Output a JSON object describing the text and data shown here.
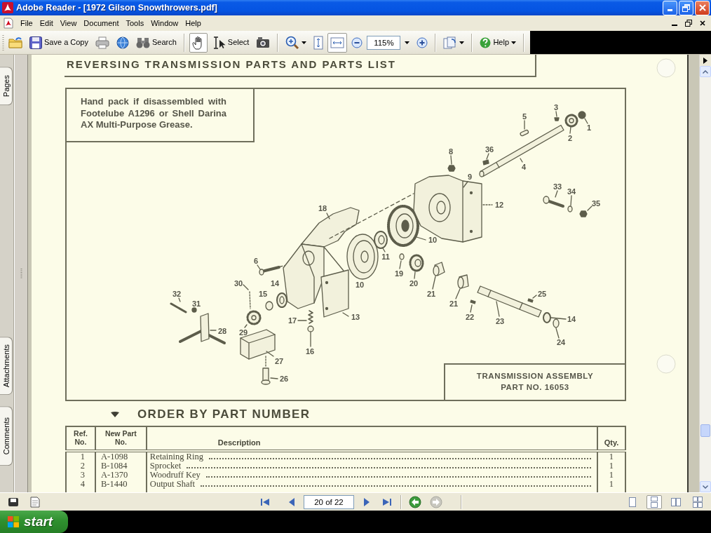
{
  "window": {
    "title": "Adobe Reader - [1972 Gilson Snowthrowers.pdf]"
  },
  "menu": [
    "File",
    "Edit",
    "View",
    "Document",
    "Tools",
    "Window",
    "Help"
  ],
  "toolbar": {
    "save_label": "Save a Copy",
    "search_label": "Search",
    "tools": [
      {
        "selected": true
      },
      {
        "label": "Select",
        "selected": false
      },
      {
        "selected": false
      }
    ],
    "page_fit": [
      {
        "selected": false
      },
      {
        "selected": true
      }
    ],
    "zoom": "115%",
    "help_label": "Help"
  },
  "nav_tabs": [
    "Pages",
    "Attachments",
    "Comments"
  ],
  "page": {
    "heading": "REVERSING TRANSMISSION PARTS AND PARTS LIST",
    "note": "Hand pack if disassembled with Footelube A1296 or Shell Darina AX Multi-Purpose Grease.",
    "callouts": [
      "3",
      "5",
      "1",
      "2",
      "8",
      "36",
      "4",
      "9",
      "33",
      "34",
      "18",
      "12",
      "35",
      "10",
      "6",
      "11",
      "19",
      "30",
      "14",
      "10",
      "20",
      "32",
      "15",
      "21",
      "25",
      "31",
      "21",
      "17",
      "13",
      "22",
      "23",
      "14",
      "28",
      "29",
      "24",
      "16",
      "27",
      "26"
    ],
    "assembly": {
      "title": "TRANSMISSION ASSEMBLY",
      "part_no": "PART NO. 16053"
    },
    "order_heading": "ORDER BY PART NUMBER",
    "table": {
      "columns": [
        "Ref. No.",
        "New Part No.",
        "Description",
        "Qty."
      ],
      "rows": [
        {
          "ref": "1",
          "part": "A-1098",
          "description": "Retaining Ring",
          "qty": "1"
        },
        {
          "ref": "2",
          "part": "B-1084",
          "description": "Sprocket",
          "qty": "1"
        },
        {
          "ref": "3",
          "part": "A-1370",
          "description": "Woodruff Key",
          "qty": "1"
        },
        {
          "ref": "4",
          "part": "B-1440",
          "description": "Output Shaft",
          "qty": "1"
        }
      ]
    }
  },
  "status_bar": {
    "page_field": "20 of 22",
    "history": [
      {
        "disabled": false
      },
      {
        "disabled": true
      }
    ],
    "layouts": [
      {
        "selected": false
      },
      {
        "selected": true
      },
      {
        "selected": false
      },
      {
        "selected": false
      }
    ]
  },
  "taskbar": {
    "start_label": "start"
  }
}
